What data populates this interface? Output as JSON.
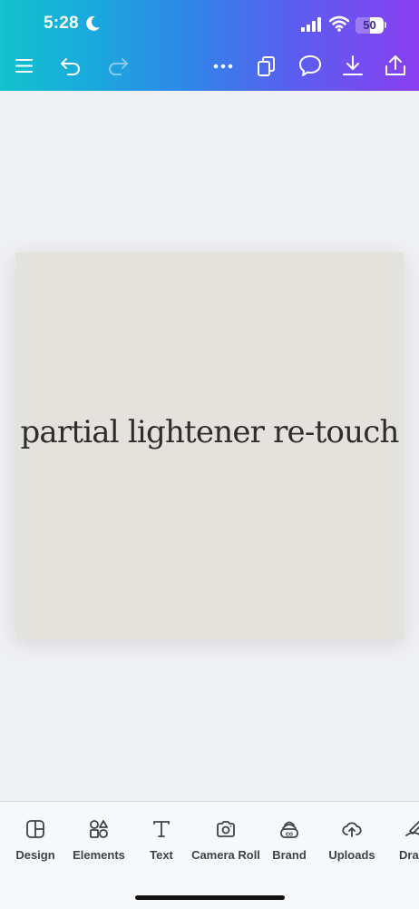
{
  "status_bar": {
    "time": "5:28",
    "battery": "50",
    "battery_level": 0.5
  },
  "toolbar": {
    "icons": [
      "menu-icon",
      "undo-icon",
      "redo-icon",
      "more-icon",
      "pages-icon",
      "comment-icon",
      "download-icon",
      "share-icon"
    ]
  },
  "canvas": {
    "text": "partial lightener re-touch",
    "background": "#e4e2dd"
  },
  "bottom_tools": [
    {
      "label": "Design",
      "icon": "design-icon"
    },
    {
      "label": "Elements",
      "icon": "elements-icon"
    },
    {
      "label": "Text",
      "icon": "text-icon"
    },
    {
      "label": "Camera Roll",
      "icon": "camera-icon"
    },
    {
      "label": "Brand",
      "icon": "brand-icon"
    },
    {
      "label": "Uploads",
      "icon": "uploads-icon"
    },
    {
      "label": "Dra",
      "icon": "draw-icon"
    }
  ],
  "colors": {
    "gradient_start": "#12c2cc",
    "gradient_end": "#8a3ff0",
    "page_background": "#eff0f4"
  }
}
